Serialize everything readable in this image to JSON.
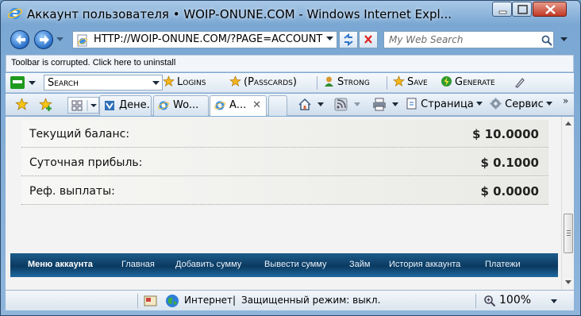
{
  "window": {
    "title": "Аккаунт пользователя • WOIP-ONUNE.COM - Windows Internet Expl..."
  },
  "address_bar": {
    "url": "HTTP://WOIP-ONUNE.COM/?PAGE=ACCOUNT",
    "search_placeholder": "My Web Search"
  },
  "warning_bar": {
    "text": "Toolbar is corrupted. Click here to uninstall"
  },
  "roboform_toolbar": {
    "search_value": "Search",
    "logins": "Logins",
    "passcards": "(Passcards)",
    "strong": "Strong",
    "save": "Save",
    "generate": "Generate"
  },
  "tabs": [
    {
      "label": "Дене..."
    },
    {
      "label": "Wo..."
    },
    {
      "label": "А..."
    }
  ],
  "command_bar": {
    "page": "Страница",
    "tools": "Сервис"
  },
  "account": {
    "rows": [
      {
        "label": "Текущий баланс:",
        "value": "$ 10.0000"
      },
      {
        "label": "Суточная прибыль:",
        "value": "$ 0.1000"
      },
      {
        "label": "Реф. выплаты:",
        "value": "$ 0.0000"
      }
    ]
  },
  "site_menu": {
    "items": [
      "Меню аккаунта",
      "Главная",
      "Добавить сумму",
      "Вывести сумму",
      "Займ",
      "История аккаунта",
      "Платежи"
    ]
  },
  "status_bar": {
    "zone": "Интернет",
    "protected_mode": "Защищенный режим: выкл.",
    "zoom": "100%"
  },
  "colors": {
    "menu_bar": "#0b3a60",
    "window_frame": "#7aa7d3"
  }
}
